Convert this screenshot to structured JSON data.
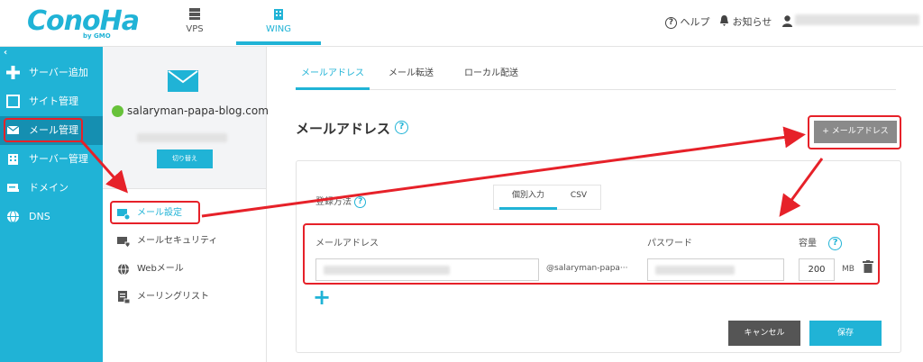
{
  "header": {
    "logo": "ConoHa",
    "logo_sub": "by GMO",
    "nav": [
      {
        "label": "VPS",
        "icon": "server-icon"
      },
      {
        "label": "WING",
        "icon": "building-icon"
      }
    ],
    "help_label": "ヘルプ",
    "notice_label": "お知らせ"
  },
  "sidebar": {
    "collapse": "‹",
    "items": [
      {
        "label": "サーバー追加",
        "icon": "plus-icon"
      },
      {
        "label": "サイト管理",
        "icon": "window-icon"
      },
      {
        "label": "メール管理",
        "icon": "mail-icon"
      },
      {
        "label": "サーバー管理",
        "icon": "server-building-icon"
      },
      {
        "label": "ドメイン",
        "icon": "domain-icon"
      },
      {
        "label": "DNS",
        "icon": "globe-icon"
      }
    ]
  },
  "panel": {
    "domain": "salaryman-papa-blog.com",
    "switch_label": "切り替え",
    "items": [
      {
        "label": "メール設定",
        "icon": "mail-settings-icon"
      },
      {
        "label": "メールセキュリティ",
        "icon": "mail-security-icon"
      },
      {
        "label": "Webメール",
        "icon": "webmail-icon"
      },
      {
        "label": "メーリングリスト",
        "icon": "mailing-list-icon"
      }
    ]
  },
  "main": {
    "tabs": [
      "メールアドレス",
      "メール転送",
      "ローカル配送"
    ],
    "title": "メールアドレス",
    "add_button": "+ メールアドレス",
    "register_label": "登録方法",
    "toggle": [
      "個別入力",
      "CSV"
    ],
    "columns": {
      "address": "メールアドレス",
      "password": "パスワード",
      "capacity": "容量"
    },
    "domain_suffix": "@salaryman-papa···",
    "capacity_value": "200",
    "capacity_unit": "MB",
    "add_row": "+",
    "cancel_label": "キャンセル",
    "save_label": "保存"
  },
  "colors": {
    "accent": "#20b3d6",
    "sidebar_active": "#158fb1",
    "annotation": "#e62129"
  }
}
